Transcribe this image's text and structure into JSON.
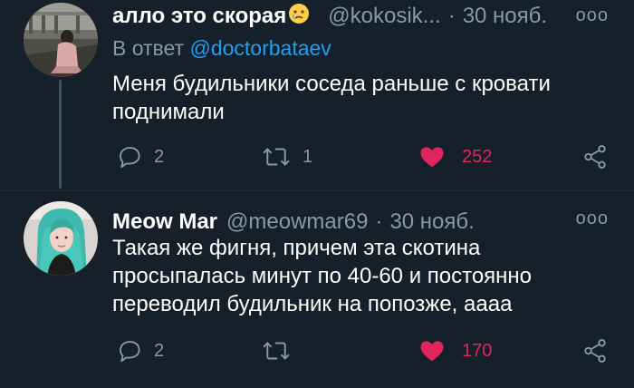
{
  "tweets": [
    {
      "author_name": "алло это скорая",
      "author_emoji": "😢",
      "handle": "@kokosik...",
      "date": "30 нояб.",
      "reply_prefix": "В ответ",
      "reply_to": "@doctorbataev",
      "text_lines": [
        "Меня будильники соседа раньше с кровати",
        "поднимали"
      ],
      "replies": "2",
      "retweets": "1",
      "likes": "252"
    },
    {
      "author_name": "Meow Mar",
      "handle": "@meowmar69",
      "date": "30 нояб.",
      "text_lines": [
        "Такая же фигня, причем эта скотина",
        "просыпалась минут по 40-60 и постоянно",
        "переводил будильник на попозже, аааа"
      ],
      "replies": "2",
      "retweets": "",
      "likes": "170"
    }
  ],
  "separator": "·",
  "more_glyph": "ooo",
  "colors": {
    "background": "#15202b",
    "secondary_text": "#8899a6",
    "link": "#1da1f2",
    "like": "#e0245e",
    "thread_line": "#3d5466"
  },
  "icons": [
    "reply-icon",
    "retweet-icon",
    "heart-icon",
    "share-icon",
    "more-icon",
    "avatar"
  ]
}
